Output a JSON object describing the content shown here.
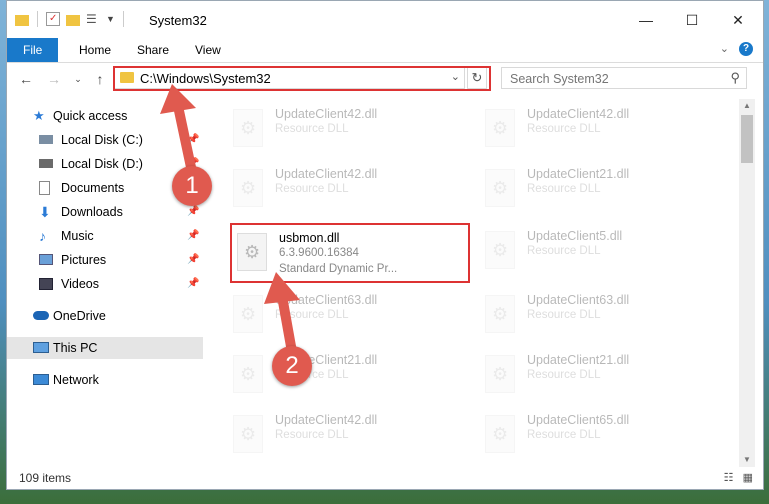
{
  "window": {
    "title": "System32",
    "controls": {
      "minimize": "—",
      "maximize": "☐",
      "close": "✕"
    }
  },
  "ribbon": {
    "tabs": [
      "File",
      "Home",
      "Share",
      "View"
    ],
    "expand": "⌄",
    "help": "?"
  },
  "navbar": {
    "address": "C:\\Windows\\System32",
    "search_placeholder": "Search System32"
  },
  "sidebar": {
    "items": [
      {
        "label": "Quick access",
        "icon": "star-icon"
      },
      {
        "label": "Local Disk (C:)",
        "icon": "drive-icon",
        "pinned": true
      },
      {
        "label": "Local Disk (D:)",
        "icon": "drive-icon",
        "pinned": true
      },
      {
        "label": "Documents",
        "icon": "documents-icon",
        "pinned": true
      },
      {
        "label": "Downloads",
        "icon": "download-icon",
        "pinned": true
      },
      {
        "label": "Music",
        "icon": "music-icon",
        "pinned": true
      },
      {
        "label": "Pictures",
        "icon": "pictures-icon",
        "pinned": true
      },
      {
        "label": "Videos",
        "icon": "videos-icon",
        "pinned": true
      },
      {
        "label": "OneDrive",
        "icon": "cloud-icon"
      },
      {
        "label": "This PC",
        "icon": "computer-icon",
        "selected": true
      },
      {
        "label": "Network",
        "icon": "network-icon"
      }
    ]
  },
  "files": {
    "left_column": [
      {
        "name": "UpdateClient42.dll",
        "type": "Resource DLL"
      },
      {
        "name": "UpdateClient42.dll",
        "type": "Resource DLL"
      },
      {
        "name": "usbmon.dll",
        "type": "6.3.9600.16384",
        "desc": "Standard Dynamic Pr..."
      },
      {
        "name": "UpdateClient63.dll",
        "type": "Resource DLL"
      },
      {
        "name": "UpdateClient21.dll",
        "type": "Resource DLL"
      },
      {
        "name": "UpdateClient42.dll",
        "type": "Resource DLL"
      }
    ],
    "right_column": [
      {
        "name": "UpdateClient42.dll",
        "type": "Resource DLL"
      },
      {
        "name": "UpdateClient21.dll",
        "type": "Resource DLL"
      },
      {
        "name": "UpdateClient5.dll",
        "type": "Resource DLL"
      },
      {
        "name": "UpdateClient63.dll",
        "type": "Resource DLL"
      },
      {
        "name": "UpdateClient21.dll",
        "type": "Resource DLL"
      },
      {
        "name": "UpdateClient65.dll",
        "type": "Resource DLL"
      }
    ]
  },
  "status": {
    "item_count": "109 items"
  },
  "annotations": {
    "step1": "1",
    "step2": "2",
    "color": "#e05a4f"
  }
}
